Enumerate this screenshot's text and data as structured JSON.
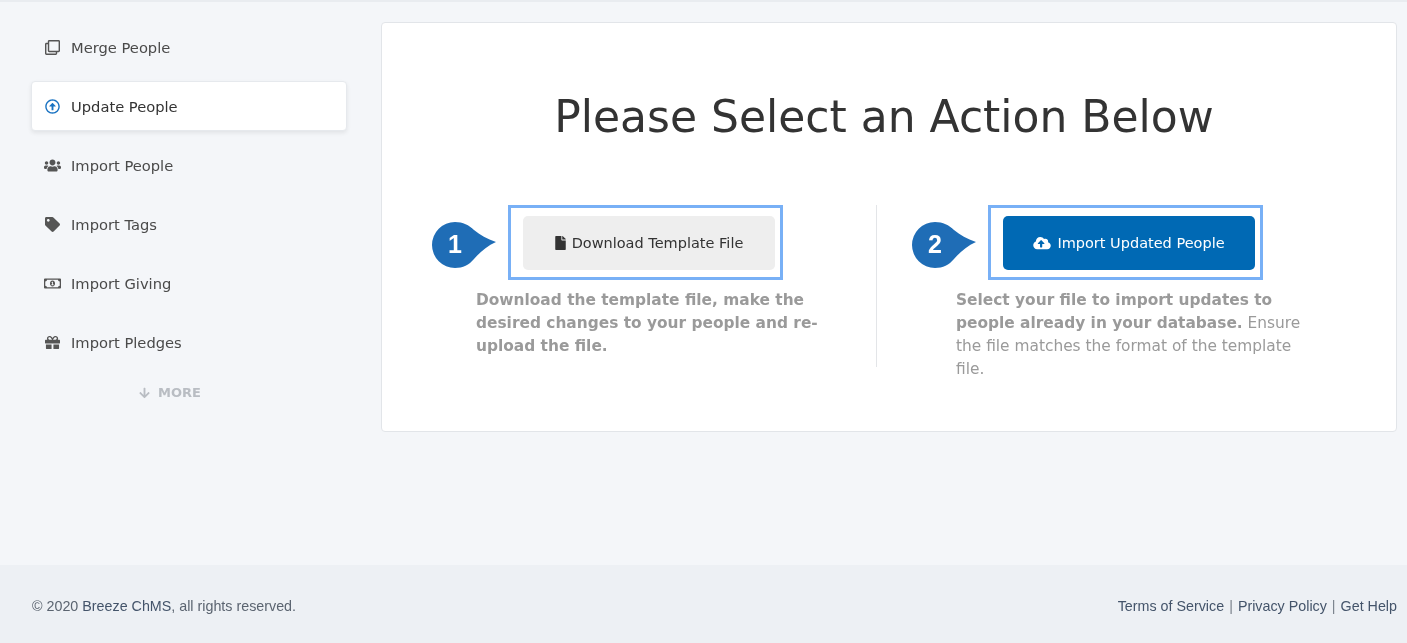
{
  "sidebar": {
    "items": [
      {
        "label": "Merge People",
        "selected": false
      },
      {
        "label": "Update People",
        "selected": true
      },
      {
        "label": "Import People",
        "selected": false
      },
      {
        "label": "Import Tags",
        "selected": false
      },
      {
        "label": "Import Giving",
        "selected": false
      },
      {
        "label": "Import Pledges",
        "selected": false
      }
    ],
    "more": {
      "label": "MORE"
    }
  },
  "main": {
    "title": "Please Select an Action Below",
    "steps": [
      {
        "number": "1",
        "highlighted": true,
        "button": {
          "label": "Download Template File",
          "kind": "secondary"
        },
        "description": "Download the template file, make the desired changes to your people and re-upload the file.",
        "description_bold": true
      },
      {
        "number": "2",
        "highlighted": true,
        "button": {
          "label": "Import Updated People",
          "kind": "primary"
        },
        "description": "**Select your file to import updates to people already in your database.** Ensure the file matches the format of the template file.",
        "description_bold": false
      }
    ]
  },
  "footer": {
    "copyright": {
      "before": "© 2020 ",
      "link": "Breeze ChMS",
      "after": ", all rights reserved."
    },
    "items": [
      {
        "kind": "link",
        "text": "Terms of Service"
      },
      {
        "kind": "separator",
        "text": "|"
      },
      {
        "kind": "link",
        "text": "Privacy Policy"
      },
      {
        "kind": "separator",
        "text": "|"
      },
      {
        "kind": "link",
        "text": "Get Help"
      }
    ]
  }
}
